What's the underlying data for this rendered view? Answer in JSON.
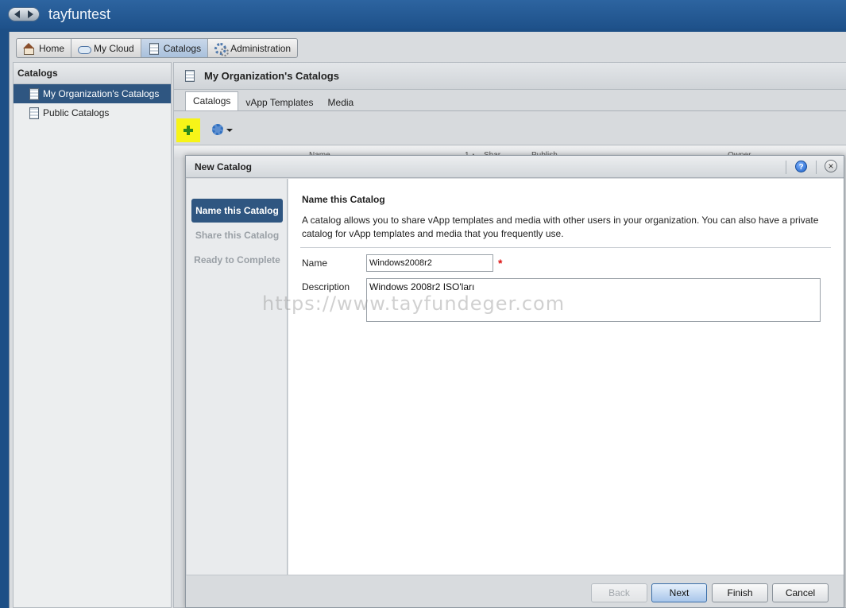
{
  "header": {
    "org_name": "tayfuntest"
  },
  "main_nav": {
    "items": [
      {
        "label": "Home",
        "icon": "home-icon"
      },
      {
        "label": "My Cloud",
        "icon": "cloud-icon"
      },
      {
        "label": "Catalogs",
        "icon": "catalog-icon",
        "active": true
      },
      {
        "label": "Administration",
        "icon": "admin-gears-icon"
      }
    ]
  },
  "left_panel": {
    "title": "Catalogs",
    "items": [
      {
        "label": "My Organization's Catalogs",
        "selected": true
      },
      {
        "label": "Public Catalogs"
      }
    ]
  },
  "content": {
    "title": "My Organization's Catalogs",
    "tabs": [
      {
        "label": "Catalogs",
        "active": true
      },
      {
        "label": "vApp Templates"
      },
      {
        "label": "Media"
      }
    ],
    "grid_columns": [
      "Name",
      "1 ▴",
      "Shar",
      "Publish",
      "Owner"
    ]
  },
  "modal": {
    "title": "New Catalog",
    "help_glyph": "?",
    "close_glyph": "×",
    "steps": [
      {
        "label": "Name this Catalog",
        "current": true
      },
      {
        "label": "Share this Catalog"
      },
      {
        "label": "Ready to Complete"
      }
    ],
    "section_title": "Name this Catalog",
    "description_text": "A catalog allows you to share vApp templates and media with other users in your organization. You can also have a private catalog for vApp templates and media that you frequently use.",
    "fields": {
      "name_label": "Name",
      "name_value": "Windows2008r2",
      "required_mark": "*",
      "description_label": "Description",
      "description_value": "Windows 2008r2 ISO'ları"
    },
    "watermark": "https://www.tayfundeger.com",
    "buttons": {
      "back": "Back",
      "next": "Next",
      "finish": "Finish",
      "cancel": "Cancel"
    }
  },
  "colors": {
    "header_blue": "#1e518a",
    "selected_blue": "#2f5681",
    "add_highlight": "#f7f418",
    "required_red": "#dd1111"
  }
}
